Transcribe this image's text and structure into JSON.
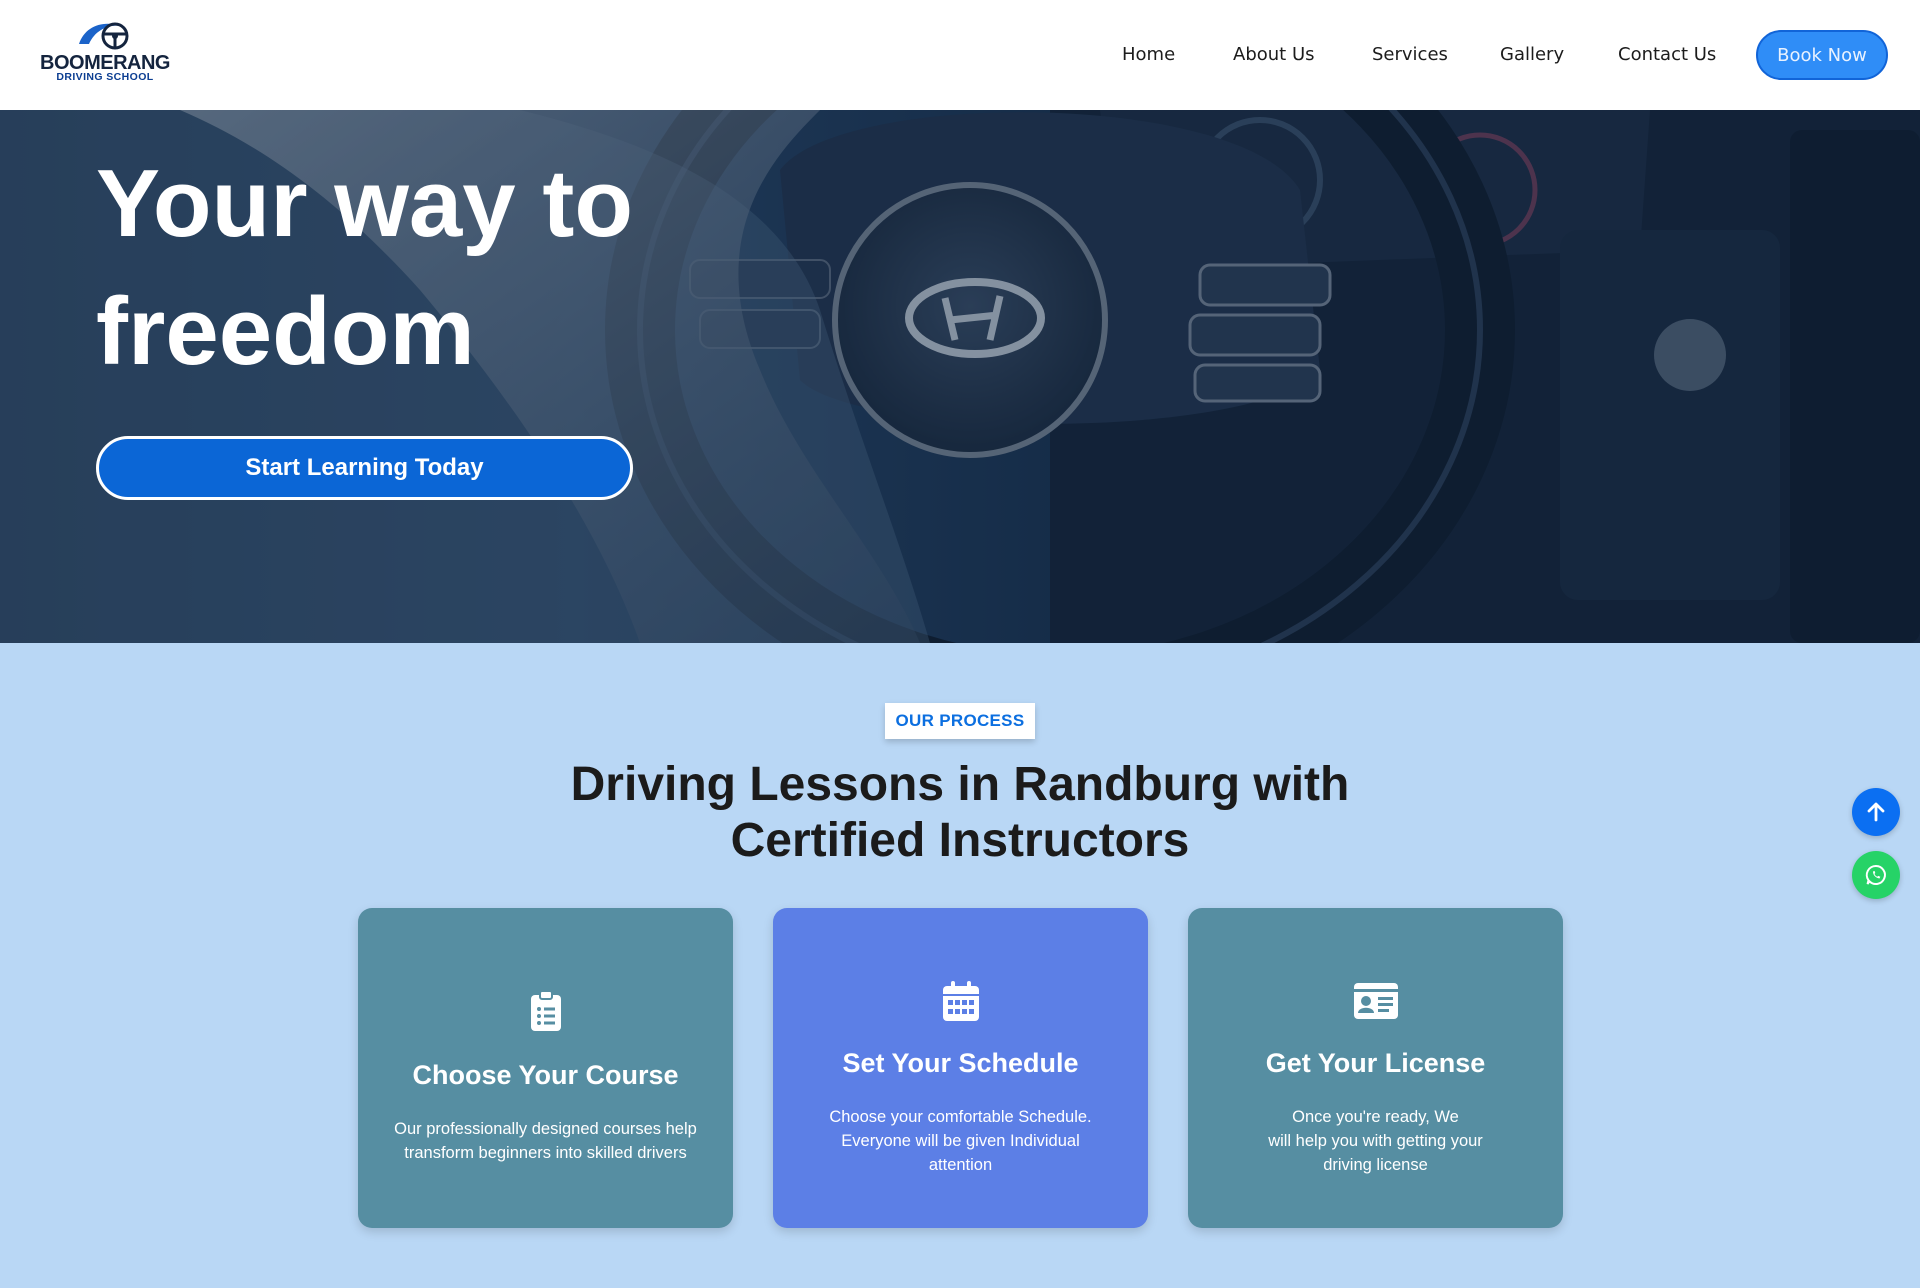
{
  "header": {
    "logo_title": "BOOMERANG",
    "logo_subtitle": "DRIVING SCHOOL",
    "nav": [
      "Home",
      "About Us",
      "Services",
      "Gallery",
      "Contact Us"
    ],
    "cta": "Book Now"
  },
  "hero": {
    "title_line1": "Your way to",
    "title_line2": "freedom",
    "button": "Start Learning Today"
  },
  "process": {
    "badge": "OUR PROCESS",
    "title_line1": "Driving Lessons in Randburg with",
    "title_line2": "Certified Instructors",
    "cards": [
      {
        "icon": "clipboard-list-icon",
        "title": "Choose Your Course",
        "text_lines": [
          "Our professionally designed courses help",
          "transform beginners into skilled drivers"
        ]
      },
      {
        "icon": "calendar-icon",
        "title": "Set Your Schedule",
        "text_lines": [
          "Choose your comfortable Schedule.",
          "Everyone will be given Individual",
          "attention"
        ]
      },
      {
        "icon": "id-card-icon",
        "title": "Get Your License",
        "text_lines": [
          "Once you're ready, We",
          "will help you with getting your",
          "driving license"
        ]
      }
    ]
  },
  "colors": {
    "brand_blue": "#0b66d6",
    "section_bg": "#b9d7f5",
    "card_teal": "#568ea2",
    "card_blue": "#5c7fe6",
    "whatsapp": "#26d367"
  }
}
